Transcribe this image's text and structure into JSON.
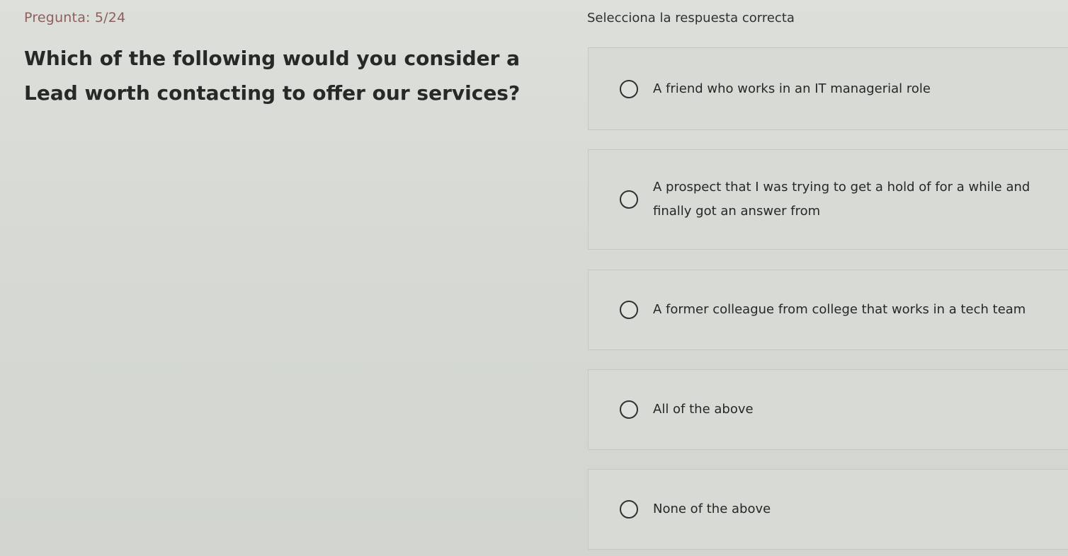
{
  "header": {
    "counter": "Pregunta: 5/24",
    "instruction": "Selecciona la respuesta correcta"
  },
  "question": {
    "text": "Which of the following would you consider a Lead worth contacting to offer our services?"
  },
  "options": [
    {
      "label": "A friend who works in an IT managerial role",
      "selected": false
    },
    {
      "label": "A prospect that I was trying to get a hold of for a while and finally got an answer from",
      "selected": false
    },
    {
      "label": "A former colleague from college that works in a tech team",
      "selected": false
    },
    {
      "label": "All of the above",
      "selected": false
    },
    {
      "label": "None of the above",
      "selected": false
    }
  ],
  "colors": {
    "background": "#d9dcd7",
    "counter_text": "#8f5e5e",
    "question_text": "#262a27"
  }
}
